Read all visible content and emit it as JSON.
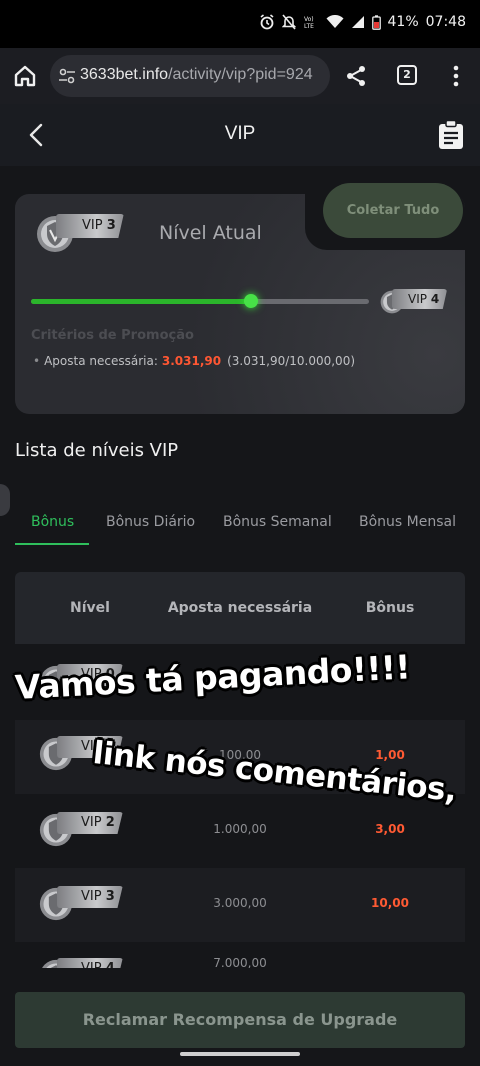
{
  "status_bar": {
    "battery": "41%",
    "time": "07:48",
    "network": "LTE"
  },
  "browser": {
    "url_domain": "3633bet.info",
    "url_path": "/activity/vip?pid=924",
    "tabs_count": "2"
  },
  "header": {
    "title": "VIP"
  },
  "vip_card": {
    "current_level_badge": "VIP",
    "current_level_num": "3",
    "current_level_label": "Nível Atual",
    "collect_button": "Coletar Tudo",
    "next_level_badge": "VIP",
    "next_level_num": "4",
    "progress": 0.65,
    "criteria_title": "Critérios de Promoção",
    "bet_required_label": "Aposta necessária:",
    "bet_current": "3.031,90",
    "bet_progress": "(3.031,90/10.000,00)"
  },
  "levels_section": {
    "title": "Lista de níveis VIP",
    "tabs": [
      "Bônus",
      "Bônus Diário",
      "Bônus Semanal",
      "Bônus Mensal"
    ],
    "active_tab": "Bônus"
  },
  "table": {
    "headers": [
      "Nível",
      "Aposta necessária",
      "Bônus"
    ],
    "rows": [
      {
        "badge": "VIP",
        "num": "0",
        "bet": "",
        "bonus": ""
      },
      {
        "badge": "VIP",
        "num": "1",
        "bet": "100,00",
        "bonus": "1,00"
      },
      {
        "badge": "VIP",
        "num": "2",
        "bet": "1.000,00",
        "bonus": "3,00"
      },
      {
        "badge": "VIP",
        "num": "3",
        "bet": "3.000,00",
        "bonus": "10,00"
      },
      {
        "badge": "VIP",
        "num": "4",
        "bet": "7.000,00",
        "bonus": ""
      }
    ]
  },
  "claim_button": "Reclamar Recompensa de Upgrade",
  "overlay_text": {
    "line1": "Vamos tá pagando!!!!",
    "line2": "link nós comentários,"
  },
  "colors": {
    "accent_green": "#2fbf5c",
    "progress_green": "#2bb52b",
    "highlight_red": "#ff5733",
    "background": "#151619"
  }
}
